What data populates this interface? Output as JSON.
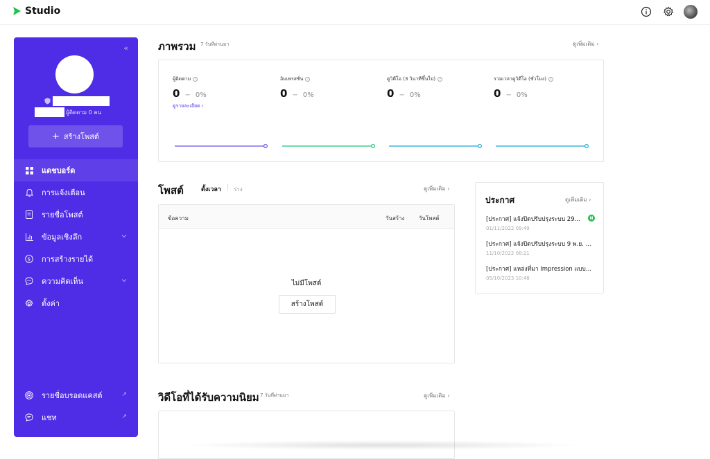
{
  "app": {
    "name": "Studio",
    "brand_color": "#1ec24a",
    "accent": "#4f2de6"
  },
  "topbar": {
    "icons": [
      "info-icon",
      "gear-icon",
      "avatar"
    ]
  },
  "sidebar": {
    "followers_text": "ผู้ติดตาม 0 คน",
    "create_label": "สร้างโพสต์",
    "nav": [
      {
        "label": "แดชบอร์ด",
        "icon": "dashboard-icon",
        "active": true
      },
      {
        "label": "การแจ้งเตือน",
        "icon": "bell-icon"
      },
      {
        "label": "รายชื่อโพสต์",
        "icon": "document-icon"
      },
      {
        "label": "ข้อมูลเชิงลึก",
        "icon": "chart-icon",
        "expandable": true
      },
      {
        "label": "การสร้างรายได้",
        "icon": "dollar-icon"
      },
      {
        "label": "ความคิดเห็น",
        "icon": "comment-icon",
        "expandable": true
      },
      {
        "label": "ตั้งค่า",
        "icon": "gear-icon"
      }
    ],
    "bottom": [
      {
        "label": "รายชื่อบรอดแคสต์",
        "icon": "broadcast-icon"
      },
      {
        "label": "แชท",
        "icon": "chat-icon"
      }
    ]
  },
  "overview": {
    "title": "ภาพรวม",
    "period": "7 วันที่ผ่านมา",
    "more": "ดูเพิ่มเติม",
    "detail_link": "ดูรายละเอียด",
    "stats": [
      {
        "label": "ผู้ติดตาม",
        "value": "0",
        "dash": "−",
        "change": "0%",
        "color": "#6a4de8"
      },
      {
        "label": "อิมเพรสชั่น",
        "value": "0",
        "dash": "−",
        "change": "0%",
        "color": "#1ec27a"
      },
      {
        "label": "ดูวิดีโอ (3 วินาทีขึ้นไป)",
        "value": "0",
        "dash": "−",
        "change": "0%",
        "color": "#1aa9d6"
      },
      {
        "label": "รวมเวลาดูวิดีโอ (ชั่วโมง)",
        "value": "0",
        "dash": "−",
        "change": "0%",
        "color": "#1aa9d6"
      }
    ]
  },
  "posts": {
    "title": "โพสต์",
    "tab_active": "ตั้งเวลา",
    "tab_other": "ร่าง",
    "more": "ดูเพิ่มเติม",
    "col_message": "ข้อความ",
    "col_created": "วันสร้าง",
    "col_posted": "วันโพสต์",
    "empty": "ไม่มีโพสต์",
    "create_btn": "สร้างโพสต์"
  },
  "announce": {
    "title": "ประกาศ",
    "more": "ดูเพิ่มเติม",
    "items": [
      {
        "title": "[ประกาศ] แจ้งปิดปรับปรุงระบบ 29...",
        "date": "01/11/2022 09:49",
        "badge": "N"
      },
      {
        "title": "[ประกาศ] แจ้งปิดปรับปรุงระบบ 9 พ.ย. ...",
        "date": "11/10/2022 08:21"
      },
      {
        "title": "[ประกาศ] แหล่งที่มา Impression แบบ...",
        "date": "05/10/2023 10:48"
      }
    ]
  },
  "popular": {
    "title": "วิดีโอที่ได้รับความนิยม",
    "period": "7 วันที่ผ่านมา",
    "more": "ดูเพิ่มเติม"
  }
}
